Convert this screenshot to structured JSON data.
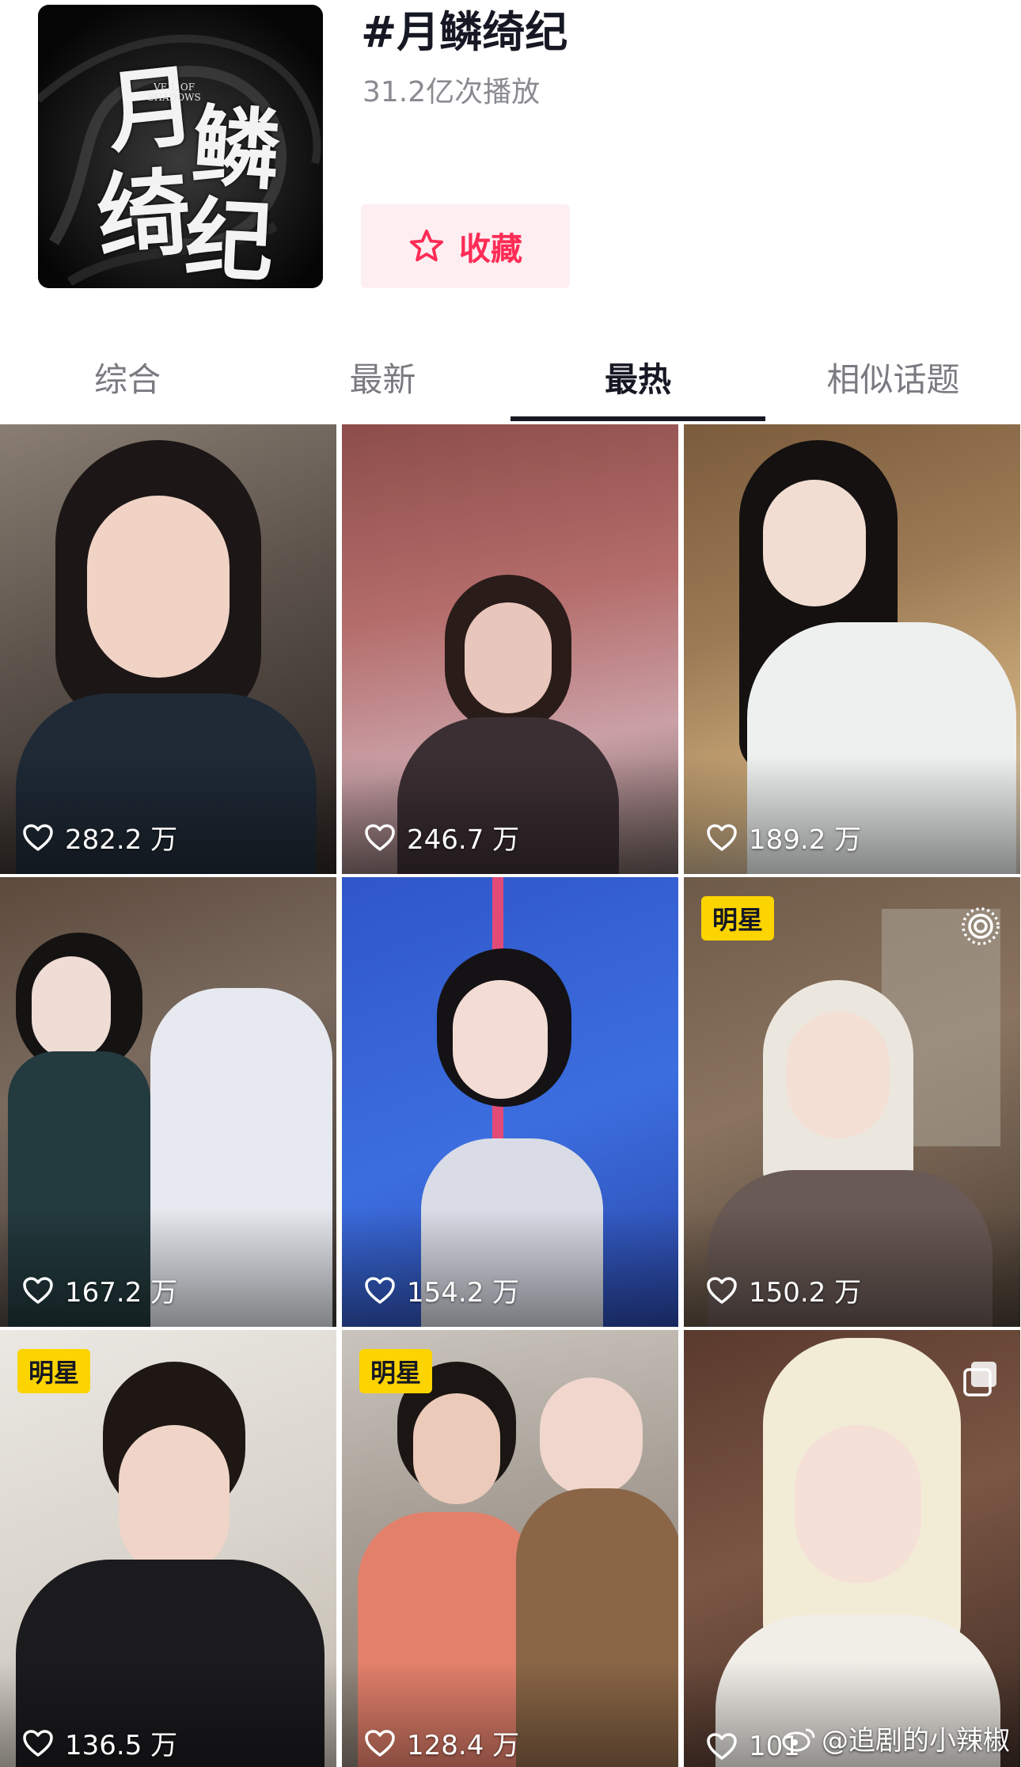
{
  "header": {
    "cover": {
      "calligraphy": [
        "月",
        "鳞",
        "绮",
        "纪"
      ],
      "english": "VEIL OF SHADOWS"
    },
    "title": "#月鳞绮纪",
    "play_count": "31.2亿次播放",
    "favorite_label": "收藏"
  },
  "tabs": [
    {
      "label": "综合",
      "active": false
    },
    {
      "label": "最新",
      "active": false
    },
    {
      "label": "最热",
      "active": true
    },
    {
      "label": "相似话题",
      "active": false
    }
  ],
  "videos": [
    {
      "likes": "282.2 万",
      "badge": "",
      "corner_icon": ""
    },
    {
      "likes": "246.7 万",
      "badge": "",
      "corner_icon": ""
    },
    {
      "likes": "189.2 万",
      "badge": "",
      "corner_icon": ""
    },
    {
      "likes": "167.2 万",
      "badge": "",
      "corner_icon": ""
    },
    {
      "likes": "154.2 万",
      "badge": "",
      "corner_icon": ""
    },
    {
      "likes": "150.2 万",
      "badge": "明星",
      "corner_icon": "live-photo-icon"
    },
    {
      "likes": "136.5 万",
      "badge": "明星",
      "corner_icon": ""
    },
    {
      "likes": "128.4 万",
      "badge": "明星",
      "corner_icon": ""
    },
    {
      "likes": "101",
      "badge": "",
      "corner_icon": "multi-image-icon"
    }
  ],
  "watermark": "@追剧的小辣椒",
  "colors": {
    "accent": "#fe2c55",
    "favorite_bg": "#fdeef1",
    "badge": "#fcd400",
    "tab_active": "#161823",
    "tab_inactive": "#7a7b80"
  }
}
